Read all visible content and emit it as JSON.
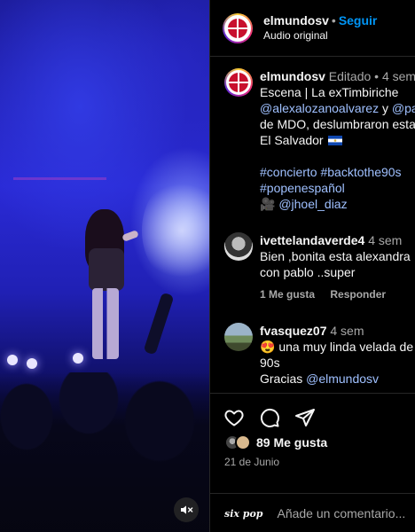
{
  "header": {
    "username": "elmundosv",
    "separator": "•",
    "follow_label": "Seguir",
    "audio_label": "Audio original"
  },
  "caption": {
    "username": "elmundosv",
    "edited_label": "Editado",
    "separator": "•",
    "time": "4 sem",
    "lines": {
      "l1": "Escena | La exTimbiriche",
      "l2_mention1": "@alexalozanoalvarez",
      "l2_and": " y ",
      "l2_mention2": "@pa",
      "l3": "de MDO, deslumbraron esta",
      "l4": "El Salvador",
      "hashtags1": "#concierto #backtothe90s",
      "hashtags2": "#popenespañol",
      "credit_icon": "🎥",
      "credit_mention": "@jhoel_diaz"
    }
  },
  "comments": [
    {
      "username": "ivettelandaverde4",
      "time": "4 sem",
      "line1": "Bien ,bonita esta alexandra",
      "line2": "con pablo ..super",
      "likes_label": "1 Me gusta",
      "reply_label": "Responder"
    },
    {
      "username": "fvasquez07",
      "time": "4 sem",
      "emoji": "😍",
      "line1": " una muy linda velada de",
      "line2": "90s",
      "line3_text": "Gracias ",
      "line3_mention": "@elmundosv"
    }
  ],
  "footer": {
    "likes_label": "89 Me gusta",
    "date": "21 de Junio",
    "emoji_button_label": "six pop",
    "comment_placeholder": "Añade un comentario..."
  },
  "icons": {
    "like": "heart-icon",
    "comment": "comment-icon",
    "share": "send-icon",
    "mute": "muted-speaker-icon"
  },
  "colors": {
    "accent": "#0095f6",
    "background": "#000000",
    "muted_text": "#a8a8a8"
  }
}
